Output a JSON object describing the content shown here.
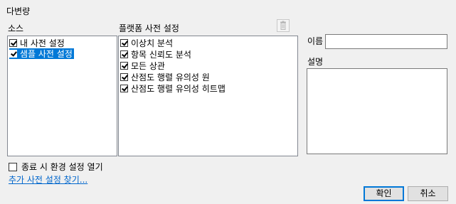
{
  "title": "다변량",
  "source": {
    "heading": "소스",
    "items": [
      {
        "label": "내 사전 설정",
        "checked": true,
        "selected": false
      },
      {
        "label": "샘플 사전 설정",
        "checked": true,
        "selected": true
      }
    ]
  },
  "platform": {
    "heading": "플랫폼 사전 설정",
    "delete_icon": "trash-icon",
    "items": [
      {
        "label": "이상치 분석",
        "checked": true
      },
      {
        "label": "항목 신뢰도 분석",
        "checked": true
      },
      {
        "label": "모든 상관",
        "checked": true
      },
      {
        "label": "산점도 행렬 유의성 원",
        "checked": true
      },
      {
        "label": "산점도 행렬 유의성 히트맵",
        "checked": true
      }
    ]
  },
  "name": {
    "label": "이름",
    "value": ""
  },
  "description": {
    "label": "설명",
    "value": ""
  },
  "open_on_exit": {
    "label": "종료 시 환경 설정 열기",
    "checked": false
  },
  "find_more_link": "추가 사전 설정 찾기...",
  "buttons": {
    "ok": "확인",
    "cancel": "취소"
  },
  "colors": {
    "selection": "#0078d7",
    "link": "#0066cc",
    "background": "#f0f0f0"
  }
}
